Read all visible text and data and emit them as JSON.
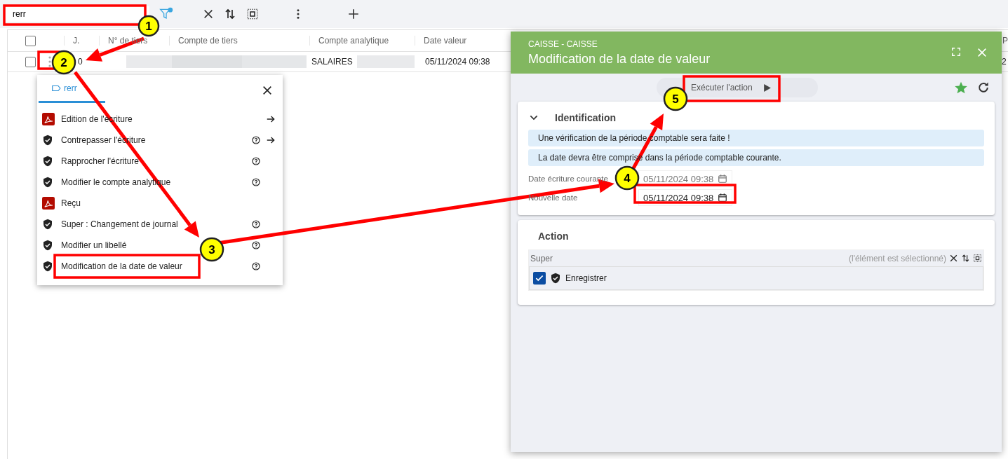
{
  "toolbar": {
    "search_value": "rerr"
  },
  "table": {
    "all_checked": false,
    "columns": [
      "J.",
      "N° de tiers",
      "Compte de tiers",
      "Compte analytique",
      "Date valeur",
      "P"
    ],
    "rows": [
      {
        "checked": false,
        "journal": "0",
        "analytic": "SALAIRES",
        "date": "05/11/2024 09:38",
        "column_6": "2"
      }
    ]
  },
  "menu": {
    "tab": "rerr",
    "items": [
      {
        "label": "Edition de l'écriture",
        "kind": "pdf",
        "help": false,
        "submenu": true
      },
      {
        "label": "Contrepasser l'écriture",
        "kind": "action",
        "help": true,
        "submenu": true
      },
      {
        "label": "Rapprocher l'écriture",
        "kind": "action",
        "help": true,
        "submenu": false
      },
      {
        "label": "Modifier le compte analytique",
        "kind": "action",
        "help": true,
        "submenu": false
      },
      {
        "label": "Reçu",
        "kind": "pdf",
        "help": false,
        "submenu": false
      },
      {
        "label": "Super : Changement de journal",
        "kind": "action",
        "help": true,
        "submenu": false
      },
      {
        "label": "Modifier un libellé",
        "kind": "action",
        "help": true,
        "submenu": false
      },
      {
        "label": "Modification de la date de valeur",
        "kind": "action",
        "help": true,
        "submenu": false
      }
    ]
  },
  "panel": {
    "subtitle": "CAISSE - CAISSE",
    "title": "Modification de la date de valeur",
    "run_button": "Exécuter l'action",
    "favorite": true,
    "identification": {
      "title": "Identification",
      "expanded": true,
      "notices": [
        "Une vérification de la période comptable sera faite !",
        "La date devra être comprise dans la période comptable courante."
      ],
      "fields": [
        {
          "label": "Date écriture courante",
          "value": "05/11/2024 09:38",
          "disabled": true
        },
        {
          "label": "Nouvelle date",
          "value": "05/11/2024 09:38",
          "disabled": false
        }
      ]
    },
    "action": {
      "title": "Action",
      "group": "Super",
      "hint": "(l'élément est sélectionné)",
      "items": [
        {
          "label": "Enregistrer",
          "checked": true
        }
      ]
    }
  },
  "callouts": [
    "1",
    "2",
    "3",
    "4",
    "5"
  ]
}
